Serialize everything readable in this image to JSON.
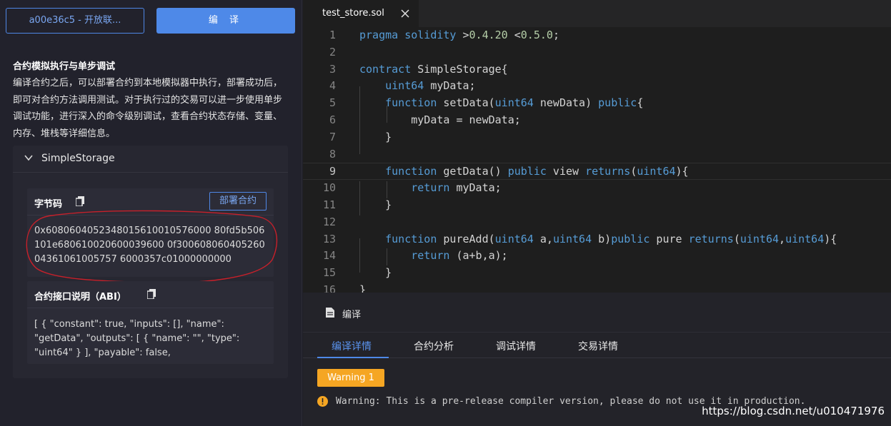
{
  "sidebar": {
    "env_select_label": "a00e36c5 - 开放联...",
    "compile_button_label": "编 译",
    "section_title": "合约模拟执行与单步调试",
    "section_description": "编译合约之后，可以部署合约到本地模拟器中执行，部署成功后，即可对合约方法调用测试。对于执行过的交易可以进一步使用单步调试功能，进行深入的命令级别调试，查看合约状态存储、变量、内存、堆栈等详细信息。",
    "contract_name": "SimpleStorage",
    "bytecode": {
      "title": "字节码",
      "deploy_label": "部署合约",
      "value": "0x6080604052348015610010576000 80fd5b506101e680610020600039600 0f30060806040526004361061005757 6000357c01000000000"
    },
    "abi": {
      "title": "合约接口说明（ABI）",
      "value": "[ { \"constant\": true, \"inputs\": [], \"name\": \"getData\", \"outputs\": [ { \"name\": \"\", \"type\": \"uint64\" } ], \"payable\": false,"
    }
  },
  "editor": {
    "tab_label": "test_store.sol",
    "lines": [
      {
        "n": "1",
        "tokens": [
          {
            "t": "pragma solidity",
            "c": "k"
          },
          {
            "t": " >",
            "c": ""
          },
          {
            "t": "0.4.20",
            "c": "n"
          },
          {
            "t": " <",
            "c": ""
          },
          {
            "t": "0.5.0",
            "c": "n"
          },
          {
            "t": ";",
            "c": ""
          }
        ]
      },
      {
        "n": "2",
        "tokens": []
      },
      {
        "n": "3",
        "tokens": [
          {
            "t": "contract",
            "c": "k"
          },
          {
            "t": " SimpleStorage{",
            "c": ""
          }
        ]
      },
      {
        "n": "4",
        "tokens": [
          {
            "t": "    ",
            "c": ""
          },
          {
            "t": "uint64",
            "c": "k"
          },
          {
            "t": " myData;",
            "c": ""
          }
        ]
      },
      {
        "n": "5",
        "tokens": [
          {
            "t": "    ",
            "c": ""
          },
          {
            "t": "function",
            "c": "k"
          },
          {
            "t": " setData(",
            "c": ""
          },
          {
            "t": "uint64",
            "c": "k"
          },
          {
            "t": " newData) ",
            "c": ""
          },
          {
            "t": "public",
            "c": "k"
          },
          {
            "t": "{",
            "c": ""
          }
        ]
      },
      {
        "n": "6",
        "tokens": [
          {
            "t": "        myData = newData;",
            "c": ""
          }
        ]
      },
      {
        "n": "7",
        "tokens": [
          {
            "t": "    }",
            "c": ""
          }
        ]
      },
      {
        "n": "8",
        "tokens": []
      },
      {
        "n": "9",
        "tokens": [
          {
            "t": "    ",
            "c": ""
          },
          {
            "t": "function",
            "c": "k"
          },
          {
            "t": " getData() ",
            "c": ""
          },
          {
            "t": "public",
            "c": "k"
          },
          {
            "t": " view ",
            "c": ""
          },
          {
            "t": "returns",
            "c": "k"
          },
          {
            "t": "(",
            "c": ""
          },
          {
            "t": "uint64",
            "c": "k"
          },
          {
            "t": "){",
            "c": ""
          }
        ]
      },
      {
        "n": "10",
        "tokens": [
          {
            "t": "        ",
            "c": ""
          },
          {
            "t": "return",
            "c": "k"
          },
          {
            "t": " myData;",
            "c": ""
          }
        ]
      },
      {
        "n": "11",
        "tokens": [
          {
            "t": "    }",
            "c": ""
          }
        ]
      },
      {
        "n": "12",
        "tokens": []
      },
      {
        "n": "13",
        "tokens": [
          {
            "t": "    ",
            "c": ""
          },
          {
            "t": "function",
            "c": "k"
          },
          {
            "t": " pureAdd(",
            "c": ""
          },
          {
            "t": "uint64",
            "c": "k"
          },
          {
            "t": " a,",
            "c": ""
          },
          {
            "t": "uint64",
            "c": "k"
          },
          {
            "t": " b)",
            "c": ""
          },
          {
            "t": "public",
            "c": "k"
          },
          {
            "t": " pure ",
            "c": ""
          },
          {
            "t": "returns",
            "c": "k"
          },
          {
            "t": "(",
            "c": ""
          },
          {
            "t": "uint64",
            "c": "k"
          },
          {
            "t": ",",
            "c": ""
          },
          {
            "t": "uint64",
            "c": "k"
          },
          {
            "t": "){",
            "c": ""
          }
        ]
      },
      {
        "n": "14",
        "tokens": [
          {
            "t": "        ",
            "c": ""
          },
          {
            "t": "return",
            "c": "k"
          },
          {
            "t": " (a+b,a);",
            "c": ""
          }
        ]
      },
      {
        "n": "15",
        "tokens": [
          {
            "t": "    }",
            "c": ""
          }
        ]
      },
      {
        "n": "16",
        "tokens": [
          {
            "t": "}",
            "c": ""
          }
        ]
      }
    ],
    "active_line": "9"
  },
  "output": {
    "title": "编译",
    "tabs": [
      "编译详情",
      "合约分析",
      "调试详情",
      "交易详情"
    ],
    "active_tab": "编译详情",
    "warning_badge": "Warning 1",
    "warning_message": "Warning: This is a pre-release compiler version, please do not use it in production."
  },
  "watermark": "https://blog.csdn.net/u010471976",
  "colors": {
    "accent": "#4e89e8",
    "warning": "#f5a623",
    "keyword": "#569cd6",
    "number": "#b5cea8"
  }
}
